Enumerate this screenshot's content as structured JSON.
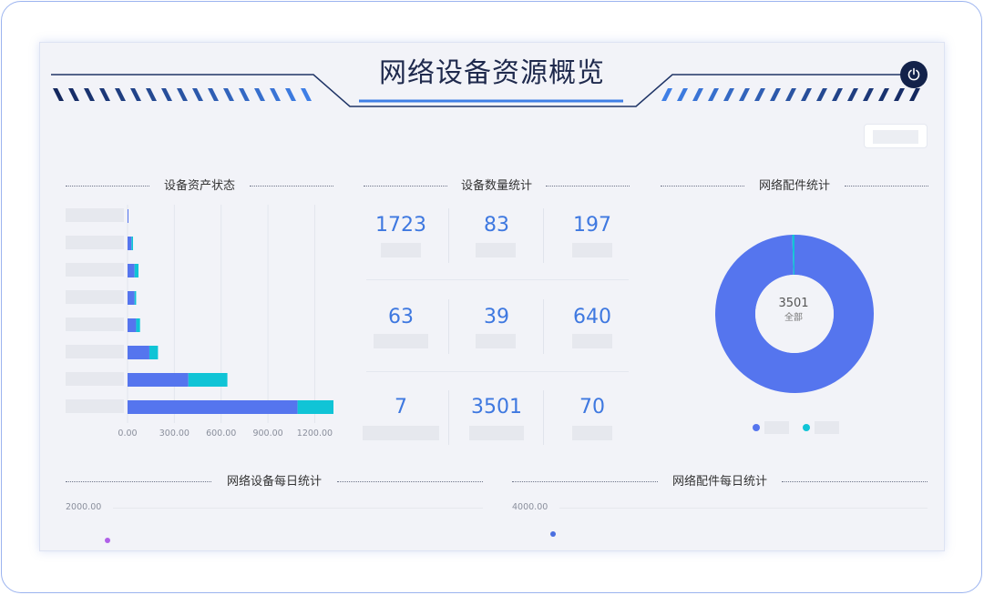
{
  "header": {
    "title": "网络设备资源概览",
    "power_icon": "power-icon",
    "accent_left": "#19306b",
    "accent_right": "#3f7fe6"
  },
  "sections": {
    "asset_status": "设备资产状态",
    "device_count": "设备数量统计",
    "parts_stats": "网络配件统计",
    "device_daily": "网络设备每日统计",
    "parts_daily": "网络配件每日统计"
  },
  "chart_data": [
    {
      "type": "bar",
      "orientation": "horizontal",
      "stacked": true,
      "categories": [
        "",
        "",
        "",
        "",
        "",
        "",
        "",
        ""
      ],
      "series": [
        {
          "color": "#5575ee",
          "values": [
            5,
            25,
            45,
            45,
            55,
            140,
            390,
            1090
          ]
        },
        {
          "color": "#10c4d6",
          "values": [
            0,
            10,
            25,
            10,
            25,
            55,
            250,
            230
          ]
        }
      ],
      "xticks": [
        "0.00",
        "300.00",
        "600.00",
        "900.00",
        "1200.00"
      ],
      "xlim": [
        0,
        1320
      ],
      "grid": true
    },
    {
      "type": "pie",
      "donut": true,
      "values": [
        3485,
        16
      ],
      "colors": [
        "#5575ee",
        "#10c4d6"
      ],
      "center_value": "3501",
      "center_label": "全部"
    }
  ],
  "stats": [
    "1723",
    "83",
    "197",
    "63",
    "39",
    "640",
    "7",
    "3501",
    "70"
  ],
  "daily": {
    "device_ymax": "2000.00",
    "parts_ymax": "4000.00"
  }
}
